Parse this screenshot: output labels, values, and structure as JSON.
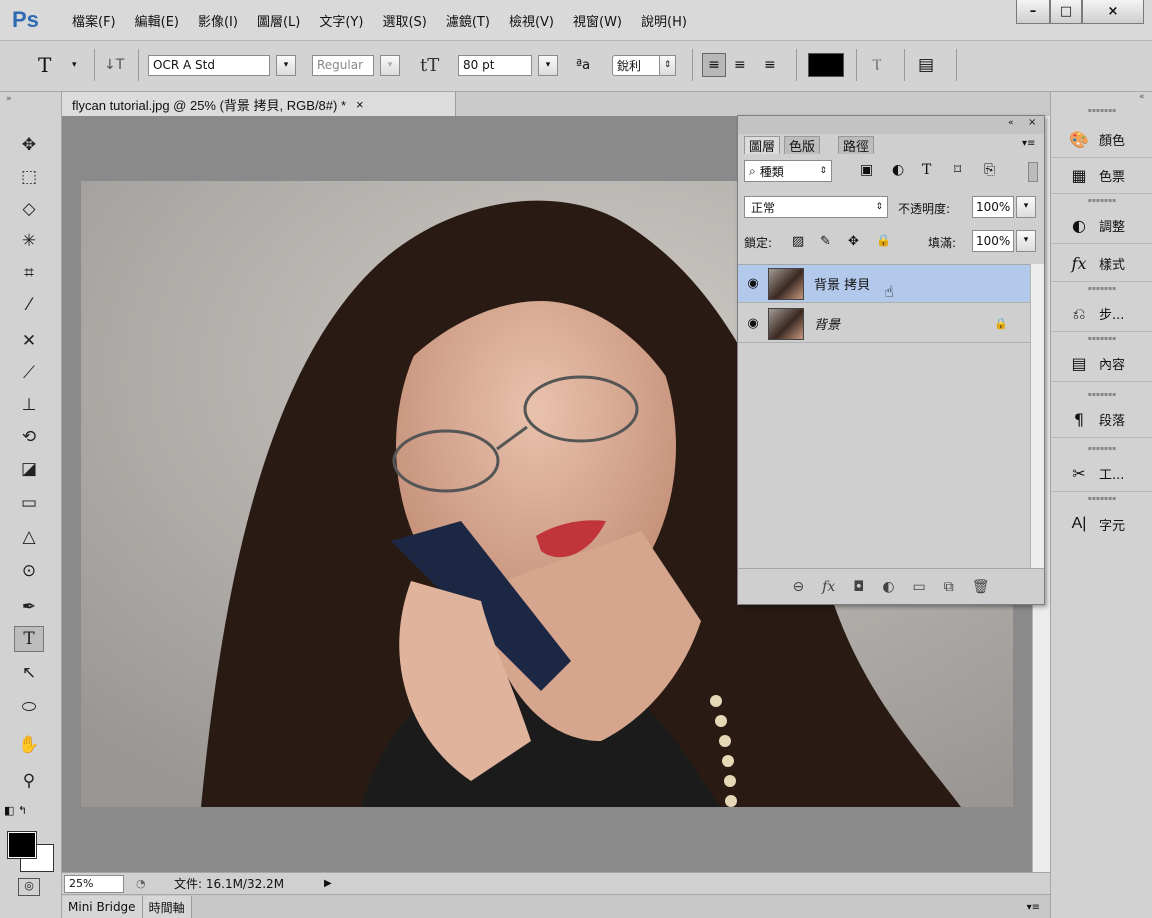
{
  "app": {
    "logo": "Ps"
  },
  "menu": [
    "檔案(F)",
    "編輯(E)",
    "影像(I)",
    "圖層(L)",
    "文字(Y)",
    "選取(S)",
    "濾鏡(T)",
    "檢視(V)",
    "視窗(W)",
    "說明(H)"
  ],
  "window_controls": {
    "minimize": "–",
    "maximize": "□",
    "close": "×"
  },
  "options": {
    "tool_glyph": "T",
    "orient_glyph": "↓T",
    "font_family": "OCR A Std",
    "font_style": "Regular",
    "size_glyph": "tT",
    "font_size": "80 pt",
    "aa_glyph": "ªa",
    "antialias": "銳利",
    "color": "#000000",
    "warp_glyph": "Ⲧ",
    "panel_glyph": "▤"
  },
  "document": {
    "tab_title": "flycan tutorial.jpg @ 25% (背景 拷貝, RGB/8#) *",
    "close": "×"
  },
  "status": {
    "zoom": "25%",
    "doc_info": "文件: 16.1M/32.2M",
    "arrow": "▶"
  },
  "bottom_tabs": [
    "Mini Bridge",
    "時間軸"
  ],
  "layers_panel": {
    "collapse": "«",
    "close": "×",
    "menu": "▾≡",
    "tabs": [
      "圖層",
      "色版",
      "路徑"
    ],
    "filter_kind": "種類",
    "filter_icons": [
      "▣",
      "◐",
      "T",
      "⌑",
      "⎘"
    ],
    "blend_mode": "正常",
    "opacity_label": "不透明度:",
    "opacity_value": "100%",
    "lock_label": "鎖定:",
    "lock_icons": [
      "▨",
      "✎",
      "✥",
      "🔒"
    ],
    "fill_label": "填滿:",
    "fill_value": "100%",
    "layers": [
      {
        "name": "背景 拷貝",
        "eye": "◉",
        "selected": true
      },
      {
        "name": "背景",
        "eye": "◉",
        "lock": "🔒",
        "selected": false
      }
    ],
    "footer_icons": [
      "⊖",
      "fx",
      "◘",
      "◐",
      "▭",
      "⧉",
      "🗑"
    ]
  },
  "right_dock": {
    "collapse": "«",
    "items": [
      {
        "icon": "🎨",
        "label": "顏色"
      },
      {
        "icon": "▦",
        "label": "色票"
      },
      {
        "icon": "◐",
        "label": "調整"
      },
      {
        "icon": "fx",
        "label": "樣式"
      },
      {
        "icon": "⎌",
        "label": "步..."
      },
      {
        "icon": "▤",
        "label": "內容"
      },
      {
        "icon": "¶",
        "label": "段落"
      },
      {
        "icon": "✂",
        "label": "工..."
      },
      {
        "icon": "A|",
        "label": "字元"
      }
    ]
  },
  "colors": {
    "selection": "#b3c9ec",
    "canvas_bg": "#8a8a8a",
    "logo": "#2f6bb4"
  }
}
